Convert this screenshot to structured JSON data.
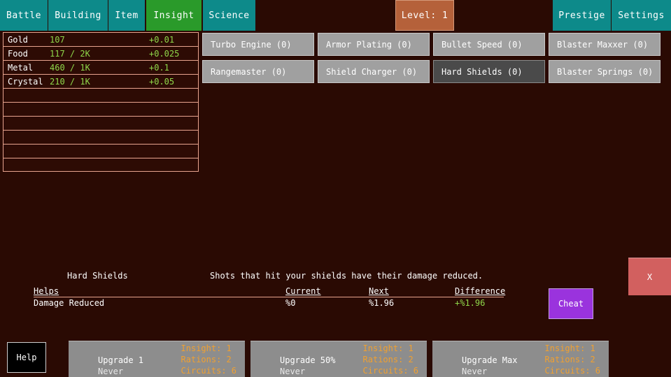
{
  "tabs": [
    {
      "label": "Battle",
      "active": false
    },
    {
      "label": "Building",
      "active": false
    },
    {
      "label": "Item",
      "active": false
    },
    {
      "label": "Insight",
      "active": true
    },
    {
      "label": "Science",
      "active": false
    }
  ],
  "level_badge": {
    "label": "Level: 1"
  },
  "right_tabs": [
    {
      "label": "Prestige"
    },
    {
      "label": "Settings"
    }
  ],
  "resources": {
    "rows": [
      {
        "name": "Gold",
        "amount": "107",
        "rate": "+0.01"
      },
      {
        "name": "Food",
        "amount": "117 / 2K",
        "rate": "+0.025"
      },
      {
        "name": "Metal",
        "amount": "460 / 1K",
        "rate": "+0.1"
      },
      {
        "name": "Crystal",
        "amount": "210 / 1K",
        "rate": "+0.05"
      },
      {
        "name": "",
        "amount": "",
        "rate": ""
      },
      {
        "name": "",
        "amount": "",
        "rate": ""
      },
      {
        "name": "",
        "amount": "",
        "rate": ""
      },
      {
        "name": "",
        "amount": "",
        "rate": ""
      },
      {
        "name": "",
        "amount": "",
        "rate": ""
      },
      {
        "name": "",
        "amount": "",
        "rate": ""
      }
    ]
  },
  "upgrades": [
    {
      "label": "Turbo Engine (0)",
      "selected": false,
      "col": 0,
      "row": 0
    },
    {
      "label": "Armor Plating (0)",
      "selected": false,
      "col": 1,
      "row": 0
    },
    {
      "label": "Bullet Speed (0)",
      "selected": false,
      "col": 2,
      "row": 0
    },
    {
      "label": "Blaster Maxxer (0)",
      "selected": false,
      "col": 3,
      "row": 0
    },
    {
      "label": "Rangemaster (0)",
      "selected": false,
      "col": 0,
      "row": 1
    },
    {
      "label": "Shield Charger (0)",
      "selected": false,
      "col": 1,
      "row": 1
    },
    {
      "label": "Hard Shields (0)",
      "selected": true,
      "col": 2,
      "row": 1
    },
    {
      "label": "Blaster Springs (0)",
      "selected": false,
      "col": 3,
      "row": 1
    }
  ],
  "detail": {
    "title": "Hard Shields",
    "description": "Shots that hit your shields have their damage reduced.",
    "headers": {
      "helps": "Helps",
      "current": "Current",
      "next": "Next",
      "difference": "Difference"
    },
    "row": {
      "label": "Damage Reduced",
      "current": "%0",
      "next": "%1.96",
      "difference": "+%1.96"
    }
  },
  "cheat_button": {
    "label": "Cheat"
  },
  "close_button": {
    "label": "X"
  },
  "help_button": {
    "label": "Help"
  },
  "purchase_buttons": [
    {
      "title": "Upgrade 1",
      "subtitle": "Never",
      "costs": [
        "Insight: 1",
        "Rations: 2",
        "Circuits: 6"
      ]
    },
    {
      "title": "Upgrade 50%",
      "subtitle": "Never",
      "costs": [
        "Insight: 1",
        "Rations: 2",
        "Circuits: 6"
      ]
    },
    {
      "title": "Upgrade Max",
      "subtitle": "Never",
      "costs": [
        "Insight: 1",
        "Rations: 2",
        "Circuits: 6"
      ]
    }
  ],
  "colors": {
    "background": "#2a0a03",
    "tab": "#0d8a8a",
    "tab_active": "#2a9a2a",
    "level_badge": "#b5613a",
    "resource_border": "#e8a48f",
    "resource_value": "#8fd84a",
    "button": "#a0a0a0",
    "button_selected": "#4a4a4a",
    "cost_text": "#f0a030",
    "cheat": "#9a33dd",
    "close": "#d2605f"
  }
}
